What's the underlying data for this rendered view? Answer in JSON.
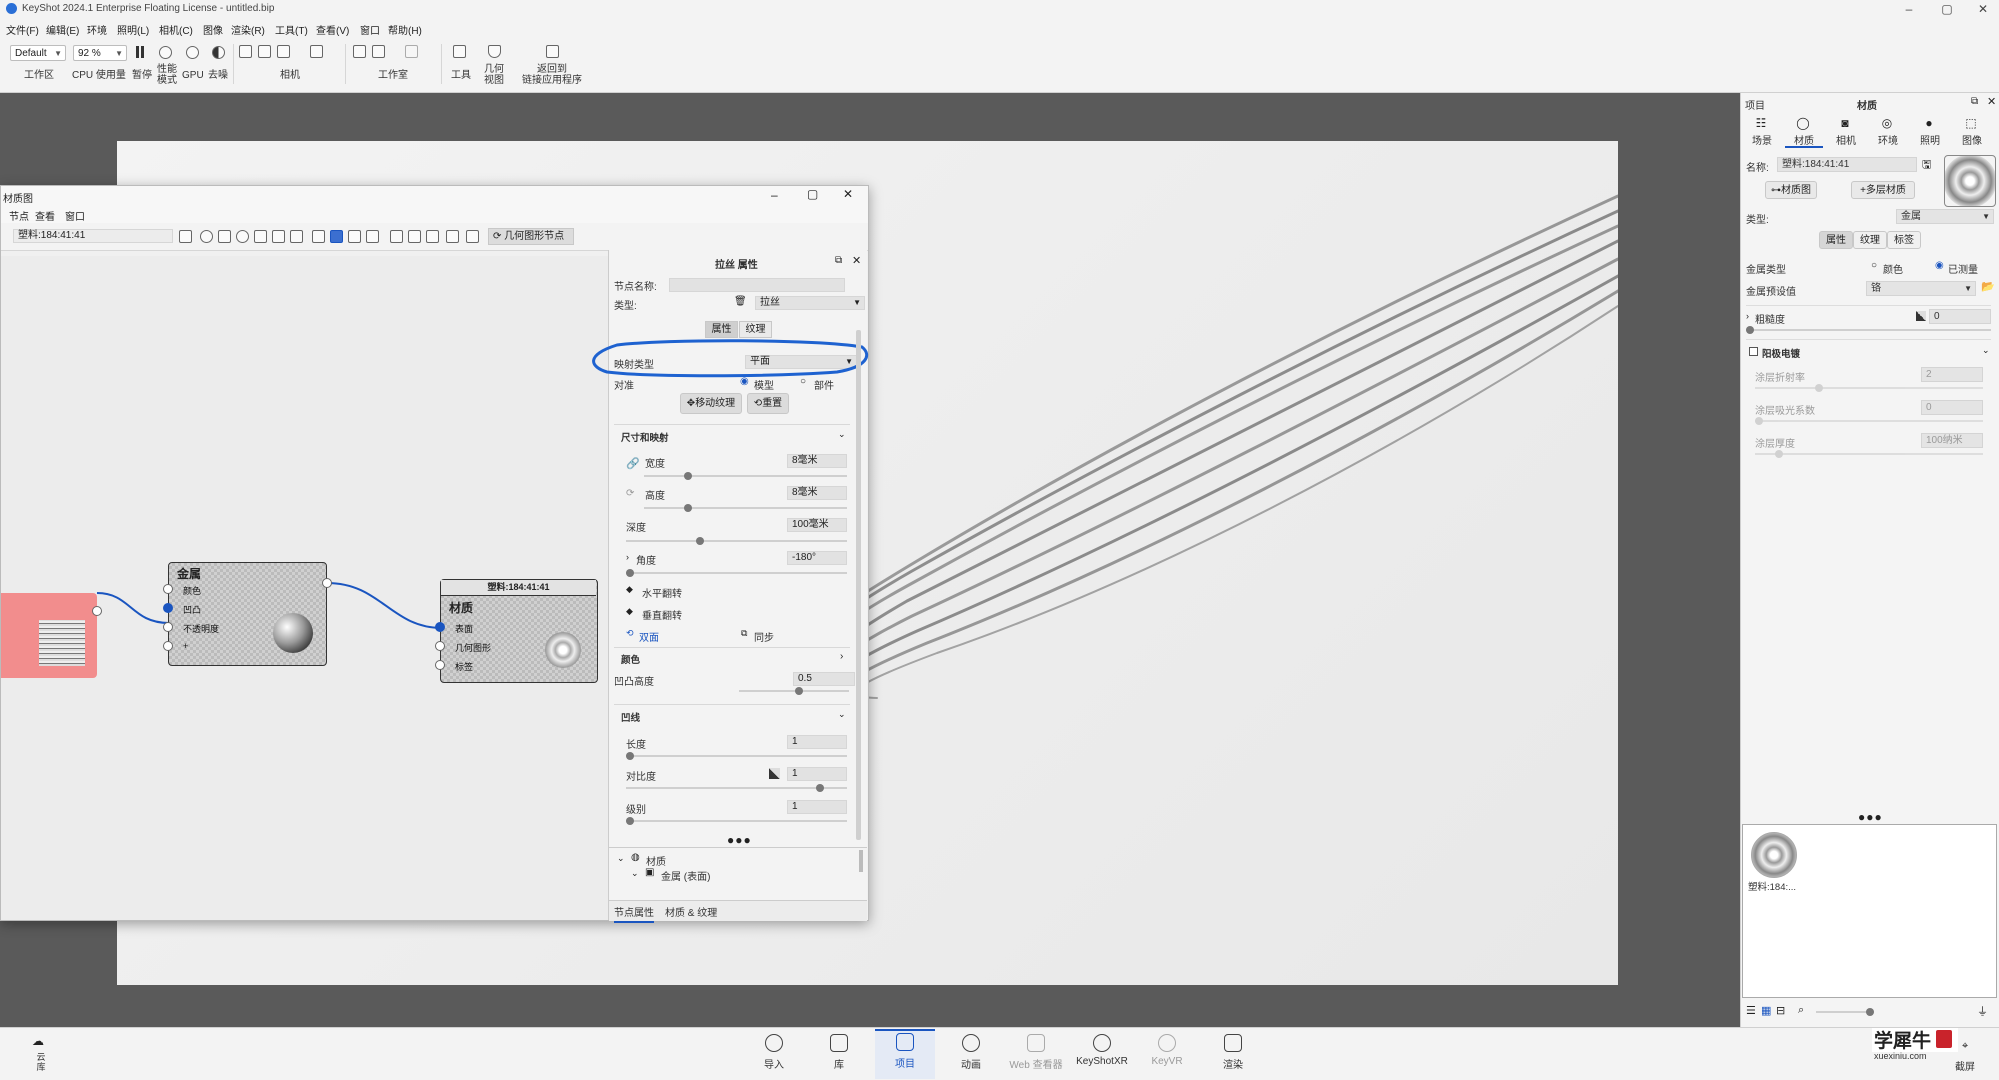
{
  "window": {
    "title": "KeyShot 2024.1 Enterprise Floating License - untitled.bip"
  },
  "menubar": [
    "文件(F)",
    "编辑(E)",
    "环境",
    "照明(L)",
    "相机(C)",
    "图像",
    "渲染(R)",
    "工具(T)",
    "查看(V)",
    "窗口",
    "帮助(H)"
  ],
  "toolbar": {
    "workspace_value": "Default",
    "zoom_value": "92 %",
    "labels": {
      "workspace": "工作区",
      "cpu": "CPU 使用量",
      "pause": "暂停",
      "perf": "性能\n模式",
      "gpu": "GPU",
      "denoise": "去噪",
      "camera": "相机",
      "studio": "工作室",
      "tools": "工具",
      "geometry": "几何\n视图",
      "return": "返回到\n链接应用程序"
    }
  },
  "material_graph": {
    "title": "材质图",
    "menu": [
      "节点",
      "查看",
      "窗口"
    ],
    "name_value": "塑料:184:41:41",
    "geometry_button": "几何图形节点",
    "metal_node": {
      "title": "金属",
      "inputs": [
        "颜色",
        "凹凸",
        "不透明度",
        "+"
      ]
    },
    "material_node": {
      "header": "塑料:184:41:41",
      "title": "材质",
      "inputs": [
        "表面",
        "几何图形",
        "标签"
      ]
    },
    "props": {
      "title": "拉丝 属性",
      "node_name_label": "节点名称:",
      "type_label": "类型:",
      "type_value": "拉丝",
      "tabs": [
        "属性",
        "纹理"
      ],
      "mapping_label": "映射类型",
      "mapping_value": "平面",
      "axis_label": "对准",
      "radio_model": "模型",
      "radio_part": "部件",
      "move_texture": "移动纹理",
      "reset": "重置",
      "section_size": "尺寸和映射",
      "width_label": "宽度",
      "width_value": "8毫米",
      "height_label": "高度",
      "height_value": "8毫米",
      "depth_label": "深度",
      "depth_value": "100毫米",
      "angle_label": "角度",
      "angle_value": "-180°",
      "flip_h": "水平翻转",
      "flip_v": "垂直翻转",
      "double_sided": "双面",
      "sync": "同步",
      "section_color": "颜色",
      "bump_label": "凹凸高度",
      "bump_value": "0.5",
      "section_bump": "凹线",
      "length_label": "长度",
      "length_value": "1",
      "contrast_label": "对比度",
      "contrast_value": "1",
      "level_label": "级别",
      "level_value": "1",
      "tree_root": "材质",
      "tree_child": "金属 (表面)",
      "bottom_tabs": [
        "节点属性",
        "材质 & 纹理"
      ]
    }
  },
  "right_panel": {
    "header_left": "项目",
    "header_center": "材质",
    "tabs": [
      "场景",
      "材质",
      "相机",
      "环境",
      "照明",
      "图像"
    ],
    "name_label": "名称:",
    "name_value": "塑料:184:41:41",
    "btn_graph": "材质图",
    "btn_multi": "多层材质",
    "type_label": "类型:",
    "type_value": "金属",
    "subtabs": [
      "属性",
      "纹理",
      "标签"
    ],
    "metal_type_label": "金属类型",
    "radio_color": "颜色",
    "radio_measured": "已测量",
    "preset_label": "金属预设值",
    "preset_value": "铬",
    "roughness_label": "粗糙度",
    "roughness_value": "0",
    "anodize_label": "阳极电镀",
    "coat_ior_label": "涂层折射率",
    "coat_ior_value": "2",
    "coat_abs_label": "涂层吸光系数",
    "coat_abs_value": "0",
    "coat_thick_label": "涂层厚度",
    "coat_thick_value": "100纳米",
    "thumb_label": "塑料:184:...",
    "watermark_cn": "学犀牛",
    "watermark_url": "xuexiniu.com",
    "screenshot_label": "截屏"
  },
  "bottombar": {
    "left_label": "云\n库",
    "items": [
      "导入",
      "库",
      "项目",
      "动画",
      "Web 查看器",
      "KeyShotXR",
      "KeyVR",
      "渲染"
    ]
  },
  "colors": {
    "accent": "#1a55c0",
    "annotation": "#1e62d0",
    "texture_node": "#f28d8d"
  }
}
